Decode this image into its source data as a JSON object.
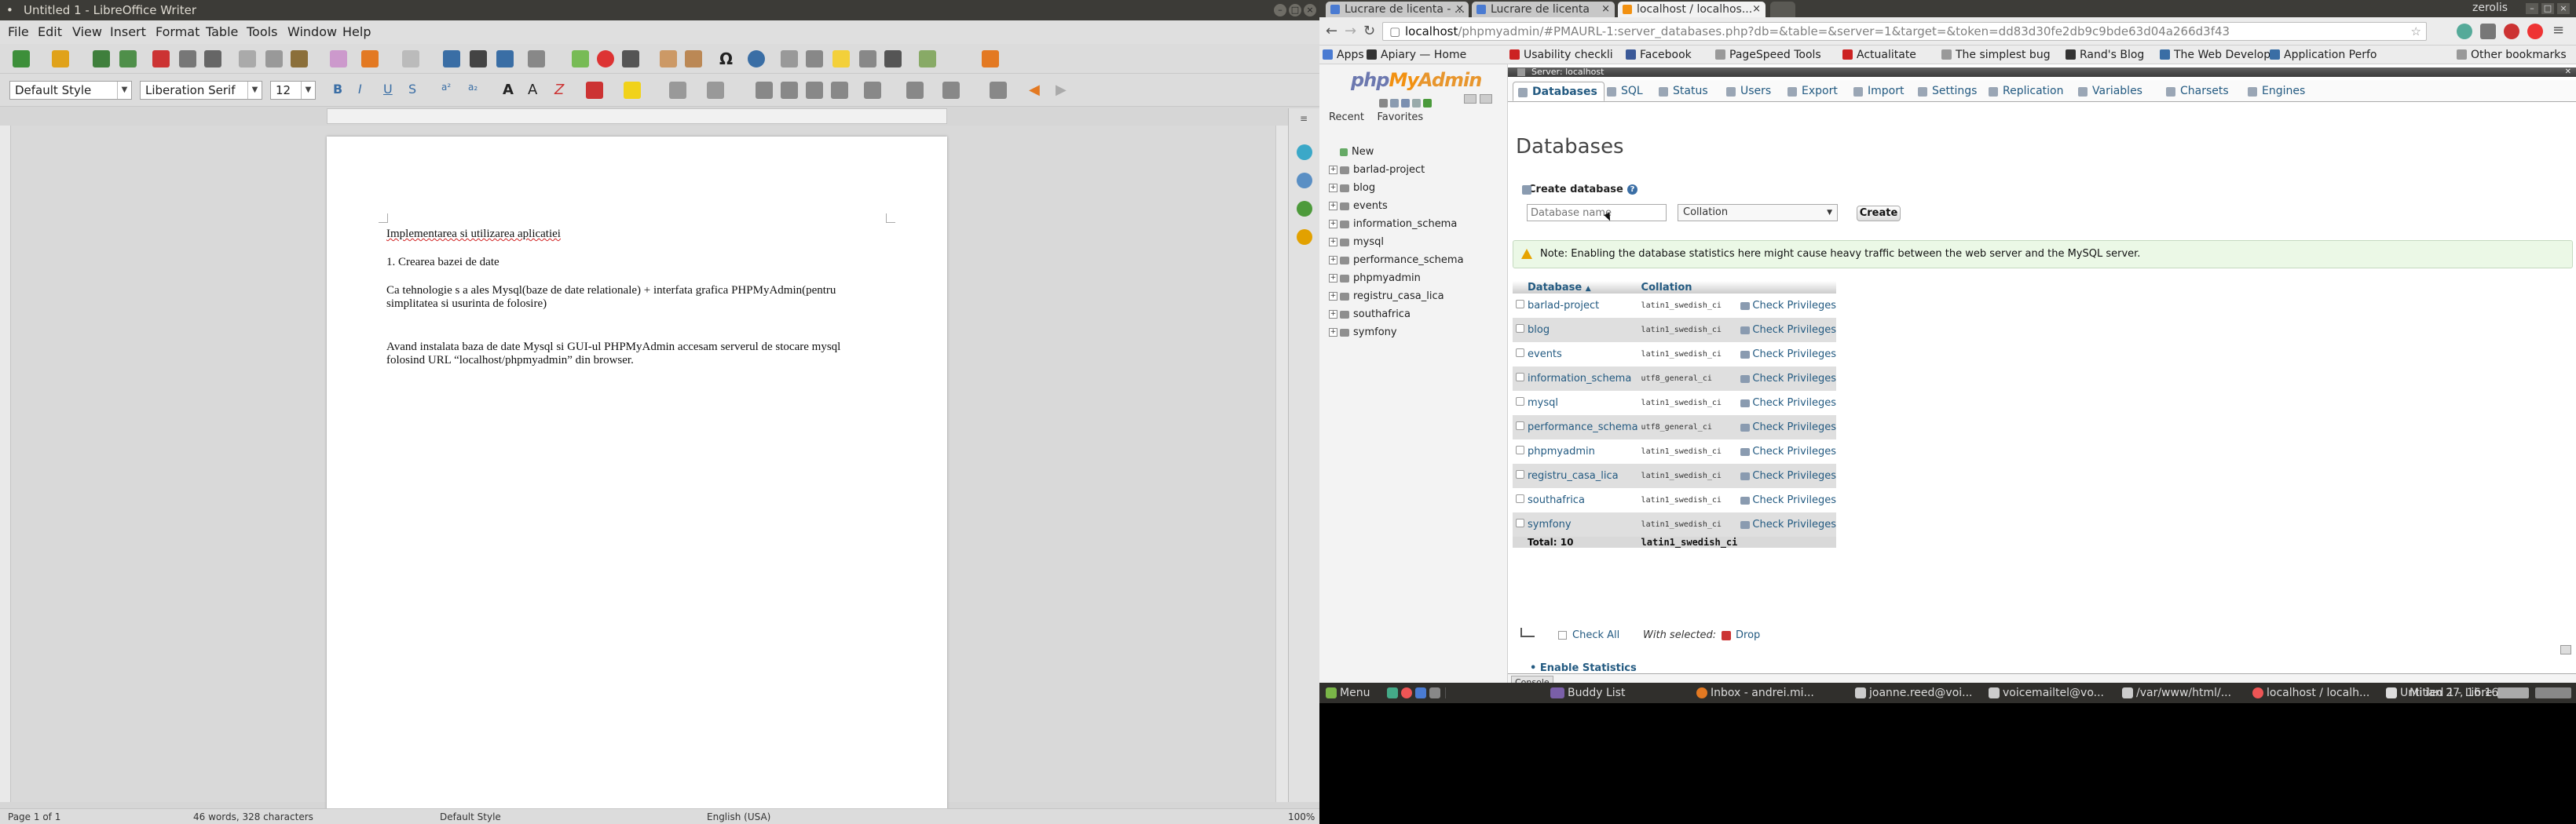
{
  "lo": {
    "title": "Untitled 1 - LibreOffice Writer",
    "menu": [
      "File",
      "Edit",
      "View",
      "Insert",
      "Format",
      "Table",
      "Tools",
      "Window",
      "Help"
    ],
    "style_value": "Default Style",
    "font_value": "Liberation Serif",
    "size_value": "12",
    "doc": {
      "p1": "Implementarea si utilizarea aplicatiei",
      "p2": "1. Crearea bazei de date",
      "p3": "Ca tehnologie s a ales Mysql(baze de date relationale) + interfata grafica PHPMyAdmin(pentru simplitatea si usurinta de folosire)",
      "p4": "Avand instalata baza de date Mysql si GUI-ul PHPMyAdmin accesam serverul de stocare mysql folosind URL “localhost/phpmyadmin” din browser."
    },
    "status": {
      "page": "Page 1 of 1",
      "words": "46 words, 328 characters",
      "style": "Default Style",
      "lang": "English (USA)",
      "zoom": "100%"
    }
  },
  "chrome": {
    "tabs": [
      "Lucrare de licenta - ...",
      "Lucrare de licenta",
      "localhost / localhos..."
    ],
    "user": "zerolis",
    "url_host": "localhost",
    "url_path": "/phpmyadmin/#PMAURL-1:server_databases.php?db=&table=&server=1&target=&token=dd83d30fe2db9c9bde63d04a266d3f43",
    "bookmarks": [
      "Apps",
      "Apiary — Home",
      "Usability checkli",
      "Facebook",
      "PageSpeed Tools",
      "Actualitate",
      "The simplest bug",
      "Rand's Blog",
      "The Web Develop",
      "Application Perfo"
    ],
    "other_bookmarks": "Other bookmarks"
  },
  "pma": {
    "logo_php": "php",
    "logo_my": "My",
    "logo_admin": "Admin",
    "recent": "Recent",
    "favorites": "Favorites",
    "tree_new": "New",
    "tree": [
      "barlad-project",
      "blog",
      "events",
      "information_schema",
      "mysql",
      "performance_schema",
      "phpmyadmin",
      "registru_casa_lica",
      "southafrica",
      "symfony"
    ],
    "server_label": "Server: localhost",
    "tabs": [
      "Databases",
      "SQL",
      "Status",
      "Users",
      "Export",
      "Import",
      "Settings",
      "Replication",
      "Variables",
      "Charsets",
      "Engines"
    ],
    "heading": "Databases",
    "create_label": "Create database",
    "db_name_placeholder": "Database name",
    "collation_placeholder": "Collation",
    "create_button": "Create",
    "notice": "Note: Enabling the database statistics here might cause heavy traffic between the web server and the MySQL server.",
    "col_database": "Database",
    "col_collation": "Collation",
    "check_priv": "Check Privileges",
    "rows": [
      {
        "name": "barlad-project",
        "coll": "latin1_swedish_ci"
      },
      {
        "name": "blog",
        "coll": "latin1_swedish_ci"
      },
      {
        "name": "events",
        "coll": "latin1_swedish_ci"
      },
      {
        "name": "information_schema",
        "coll": "utf8_general_ci"
      },
      {
        "name": "mysql",
        "coll": "latin1_swedish_ci"
      },
      {
        "name": "performance_schema",
        "coll": "utf8_general_ci"
      },
      {
        "name": "phpmyadmin",
        "coll": "latin1_swedish_ci"
      },
      {
        "name": "registru_casa_lica",
        "coll": "latin1_swedish_ci"
      },
      {
        "name": "southafrica",
        "coll": "latin1_swedish_ci"
      },
      {
        "name": "symfony",
        "coll": "latin1_swedish_ci"
      }
    ],
    "total_label": "Total: 10",
    "total_coll": "latin1_swedish_ci",
    "check_all": "Check All",
    "with_selected": "With selected:",
    "drop": "Drop",
    "enable_stats": "Enable Statistics",
    "console": "Console"
  },
  "taskbar": {
    "menu": "Menu",
    "items": [
      "Buddy List",
      "Inbox - andrei.mi...",
      "joanne.reed@voi...",
      "voicemailtel@vo...",
      "/var/www/html/...",
      "localhost / localh...",
      "Untitled 1 - Libre..."
    ],
    "clock": "Mi ian 27, 16:16"
  },
  "colors": {
    "pma_link": "#235a81",
    "lo_bg": "#d6d6d6",
    "notice_bg": "#ebf8e6"
  }
}
